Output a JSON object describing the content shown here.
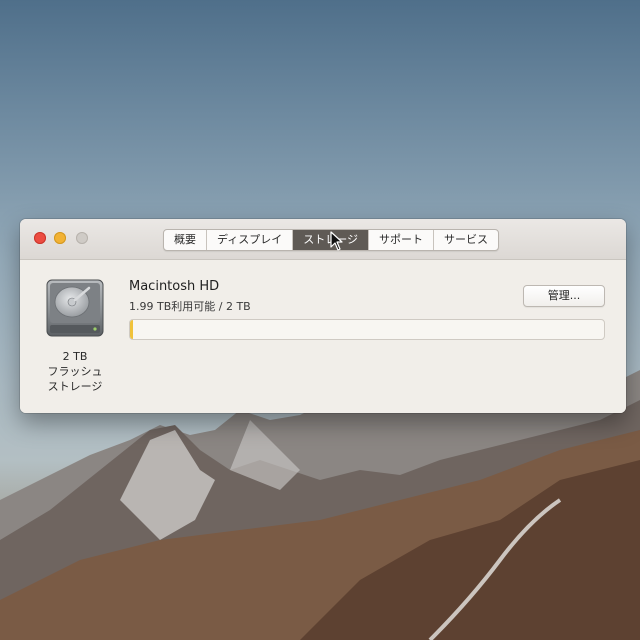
{
  "window": {
    "tabs": [
      {
        "label": "概要"
      },
      {
        "label": "ディスプレイ"
      },
      {
        "label": "ストレージ"
      },
      {
        "label": "サポート"
      },
      {
        "label": "サービス"
      }
    ],
    "active_tab": "ストレージ"
  },
  "storage": {
    "drive_name": "Macintosh HD",
    "usage_text": "1.99 TB利用可能 / 2 TB",
    "manage_label": "管理...",
    "capacity_line": "2 TB",
    "type_line1": "フラッシュ",
    "type_line2": "ストレージ",
    "used_fraction": 0.005
  },
  "colors": {
    "close": "#ec4c41",
    "minimize": "#f2b234",
    "zoom": "#cfcbc6",
    "storage_fill": "#f0c23a",
    "active_tab": "#5f5a55"
  },
  "icons": [
    "hard-drive-icon",
    "mouse-cursor-icon"
  ]
}
